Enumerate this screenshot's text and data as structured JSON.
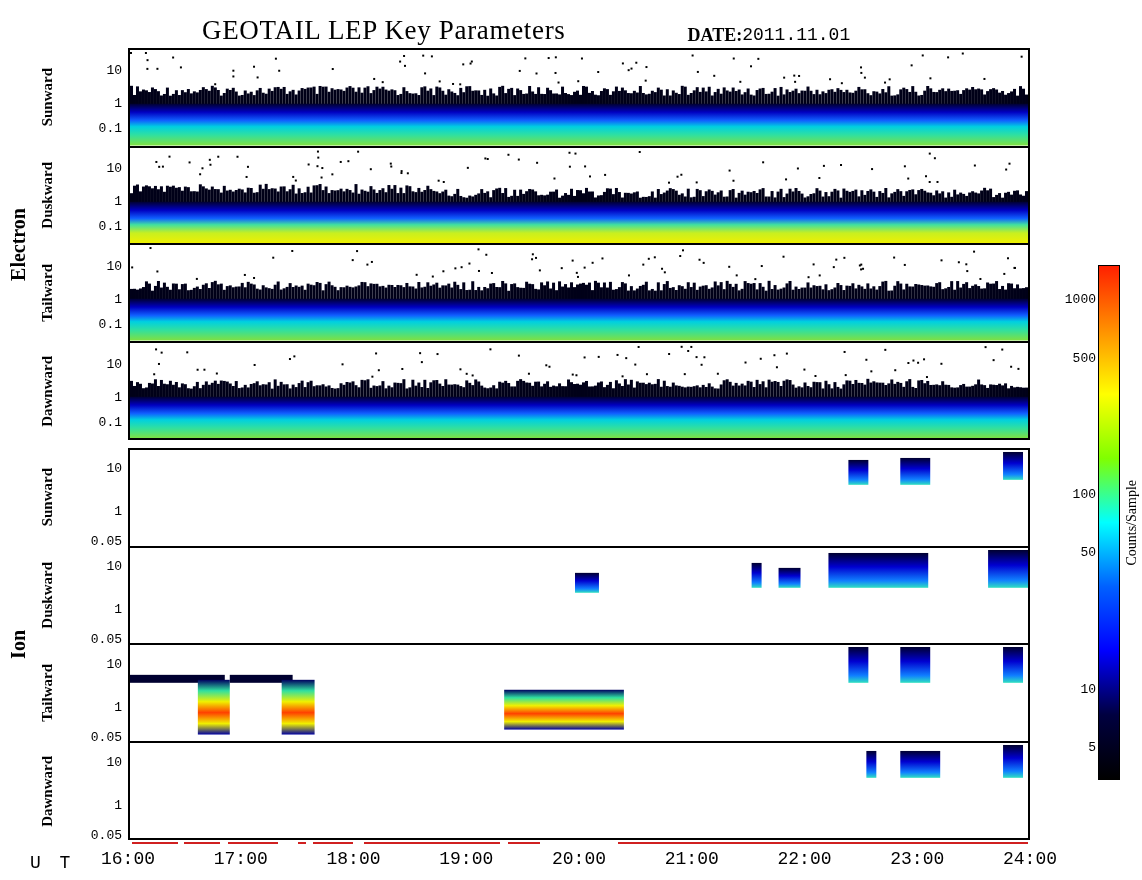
{
  "title": "GEOTAIL LEP Key Parameters",
  "date": {
    "label": "DATE:",
    "value": "2011.11.01"
  },
  "groups": [
    {
      "name": "Electron",
      "kind": "electron",
      "panels": [
        {
          "label": "Sunward",
          "yticks": [
            "10",
            "1",
            "0.1"
          ]
        },
        {
          "label": "Duskward",
          "yticks": [
            "10",
            "1",
            "0.1"
          ]
        },
        {
          "label": "Tailward",
          "yticks": [
            "10",
            "1",
            "0.1"
          ]
        },
        {
          "label": "Dawnward",
          "yticks": [
            "10",
            "1",
            "0.1"
          ]
        }
      ]
    },
    {
      "name": "Ion",
      "kind": "ion",
      "panels": [
        {
          "label": "Sunward",
          "yticks": [
            "10",
            "1",
            "0.05"
          ]
        },
        {
          "label": "Duskward",
          "yticks": [
            "10",
            "1",
            "0.05"
          ]
        },
        {
          "label": "Tailward",
          "yticks": [
            "10",
            "1",
            "0.05"
          ]
        },
        {
          "label": "Dawnward",
          "yticks": [
            "10",
            "1",
            "0.05"
          ]
        }
      ]
    }
  ],
  "colorbar": {
    "label": "Counts/Sample",
    "ticks": [
      "1000",
      "500",
      "100",
      "50",
      "10",
      "5"
    ]
  },
  "time_axis": {
    "label": "U T",
    "ticks": [
      "16:00",
      "17:00",
      "18:00",
      "19:00",
      "20:00",
      "21:00",
      "22:00",
      "23:00",
      "24:00"
    ]
  }
}
